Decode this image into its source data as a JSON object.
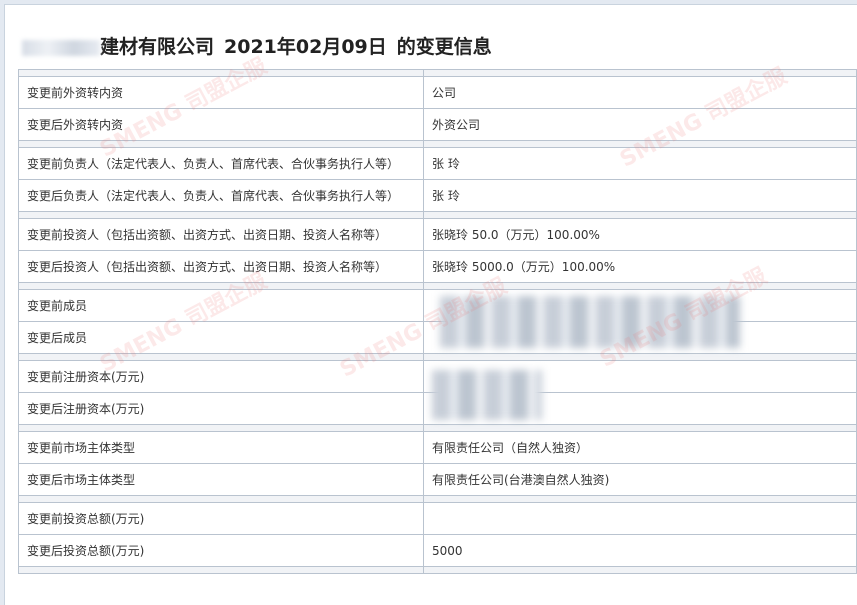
{
  "title": {
    "company": "建材有限公司",
    "date": "2021年02月09日",
    "suffix": "的变更信息"
  },
  "rows": [
    {
      "label": "变更前外资转内资",
      "value": "公司"
    },
    {
      "label": "变更后外资转内资",
      "value": "外资公司"
    },
    {
      "label": "变更前负责人（法定代表人、负责人、首席代表、合伙事务执行人等）",
      "value": "张  玲"
    },
    {
      "label": "变更后负责人（法定代表人、负责人、首席代表、合伙事务执行人等）",
      "value": "张  玲"
    },
    {
      "label": "变更前投资人（包括出资额、出资方式、出资日期、投资人名称等）",
      "value": "张晓玲 50.0（万元）100.00%"
    },
    {
      "label": "变更后投资人（包括出资额、出资方式、出资日期、投资人名称等）",
      "value": "张晓玲 5000.0（万元）100.00%"
    },
    {
      "label": "变更前成员",
      "value": ""
    },
    {
      "label": "变更后成员",
      "value": ""
    },
    {
      "label": "变更前注册资本(万元)",
      "value": ""
    },
    {
      "label": "变更后注册资本(万元)",
      "value": ""
    },
    {
      "label": "变更前市场主体类型",
      "value": "有限责任公司（自然人独资）"
    },
    {
      "label": "变更后市场主体类型",
      "value": "有限责任公司(台港澳自然人独资)"
    },
    {
      "label": "变更前投资总额(万元)",
      "value": ""
    },
    {
      "label": "变更后投资总额(万元)",
      "value": "5000"
    }
  ],
  "watermark": "SMENG 司盟企服"
}
